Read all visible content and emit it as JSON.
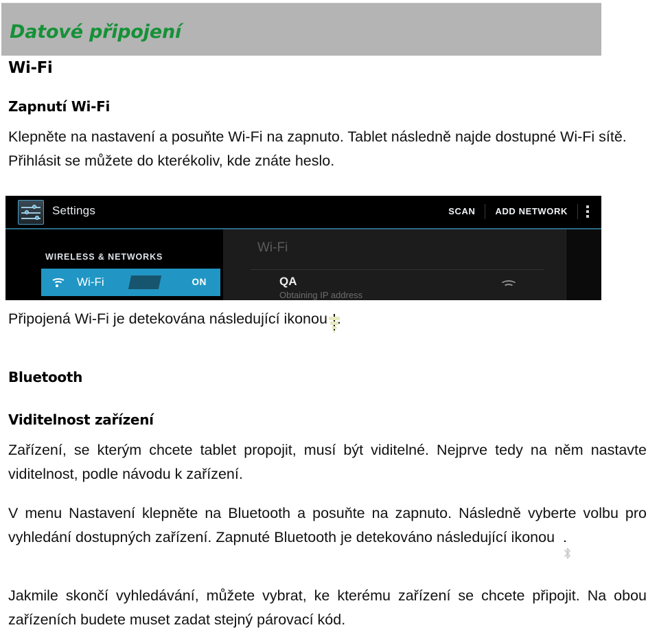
{
  "banner": {
    "title": "Datové připojení",
    "accent_color": "#159137",
    "background_color": "#b4b4b4"
  },
  "sections": {
    "wifi_heading": "Wi-Fi",
    "wifi_sub_heading": "Zapnutí Wi-Fi",
    "wifi_paragraph": "Klepněte na nastavení a posuňte Wi-Fi na zapnuto. Tablet následně najde dostupné Wi-Fi sítě. Přihlásit se můžete do kterékoliv, kde znáte heslo.",
    "wifi_icon_caption_before": "Připojená Wi-Fi je detekována následující ikonou",
    "wifi_icon_caption_after": ".",
    "bluetooth_heading": "Bluetooth",
    "bluetooth_sub_heading": "Viditelnost zařízení",
    "bluetooth_paragraph_1": "Zařízení, se kterým chcete tablet propojit, musí být viditelné. Nejprve tedy na něm nastavte viditelnost, podle návodu k zařízení.",
    "bluetooth_paragraph_2_before": "V menu Nastavení klepněte na Bluetooth a posuňte na zapnuto. Následně vyberte volbu pro vyhledání dostupných zařízení. Zapnuté Bluetooth je detekováno následující ikonou",
    "bluetooth_paragraph_2_after": ".",
    "bluetooth_paragraph_3": "Jakmile skončí vyhledávání, můžete vybrat, ke kterému zařízení se chcete připojit. Na obou zařízeních budete muset zadat stejný párovací kód."
  },
  "screenshot": {
    "app_title": "Settings",
    "actions": {
      "scan": "SCAN",
      "add_network": "ADD NETWORK"
    },
    "sidebar": {
      "section_label": "WIRELESS & NETWORKS",
      "wifi_item_label": "Wi-Fi",
      "wifi_toggle_state": "ON"
    },
    "content": {
      "panel_title": "Wi-Fi",
      "network_name": "QA",
      "network_status": "Obtaining IP address"
    },
    "accent_color": "#2196c4"
  }
}
